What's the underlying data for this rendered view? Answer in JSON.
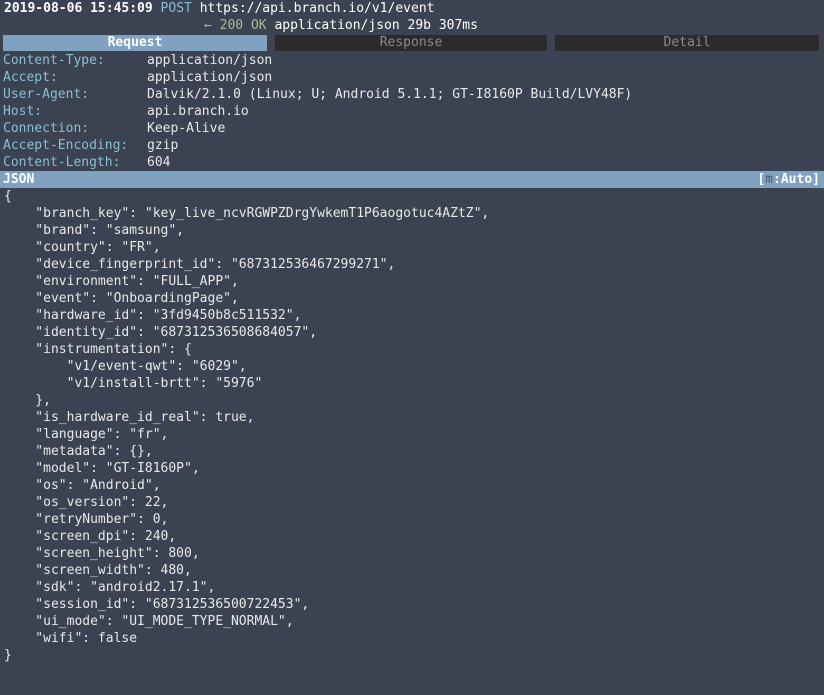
{
  "flow": {
    "timestamp": "2019-08-06 15:45:09",
    "method": "POST",
    "url": "https://api.branch.io/v1/event",
    "response_arrow": "← 200 OK",
    "response_meta": "application/json 29b 307ms"
  },
  "tabs": [
    {
      "label": "Request",
      "active": true
    },
    {
      "label": "Response",
      "active": false
    },
    {
      "label": "Detail",
      "active": false
    }
  ],
  "headers": [
    {
      "key": "Content-Type:",
      "value": "application/json"
    },
    {
      "key": "Accept:",
      "value": "application/json"
    },
    {
      "key": "User-Agent:",
      "value": "Dalvik/2.1.0 (Linux; U; Android 5.1.1; GT-I8160P Build/LVY48F)"
    },
    {
      "key": "Host:",
      "value": "api.branch.io"
    },
    {
      "key": "Connection:",
      "value": "Keep-Alive"
    },
    {
      "key": "Accept-Encoding:",
      "value": "gzip"
    },
    {
      "key": "Content-Length:",
      "value": "604"
    }
  ],
  "body_bar": {
    "title": "JSON",
    "mode_open": "[",
    "mode_key": "m",
    "mode_label": ":Auto]"
  },
  "json_lines": [
    "{",
    "    \"branch_key\": \"key_live_ncvRGWPZDrgYwkemT1P6aogotuc4AZtZ\",",
    "    \"brand\": \"samsung\",",
    "    \"country\": \"FR\",",
    "    \"device_fingerprint_id\": \"687312536467299271\",",
    "    \"environment\": \"FULL_APP\",",
    "    \"event\": \"OnboardingPage\",",
    "    \"hardware_id\": \"3fd9450b8c511532\",",
    "    \"identity_id\": \"687312536508684057\",",
    "    \"instrumentation\": {",
    "        \"v1/event-qwt\": \"6029\",",
    "        \"v1/install-brtt\": \"5976\"",
    "    },",
    "    \"is_hardware_id_real\": true,",
    "    \"language\": \"fr\",",
    "    \"metadata\": {},",
    "    \"model\": \"GT-I8160P\",",
    "    \"os\": \"Android\",",
    "    \"os_version\": 22,",
    "    \"retryNumber\": 0,",
    "    \"screen_dpi\": 240,",
    "    \"screen_height\": 800,",
    "    \"screen_width\": 480,",
    "    \"sdk\": \"android2.17.1\",",
    "    \"session_id\": \"687312536500722453\",",
    "    \"ui_mode\": \"UI_MODE_TYPE_NORMAL\",",
    "    \"wifi\": false",
    "}"
  ],
  "colors": {
    "background": "#3b4252",
    "accent_bar": "#81a1c1",
    "header_key": "#88c0d0",
    "status_ok": "#a3be8c"
  }
}
